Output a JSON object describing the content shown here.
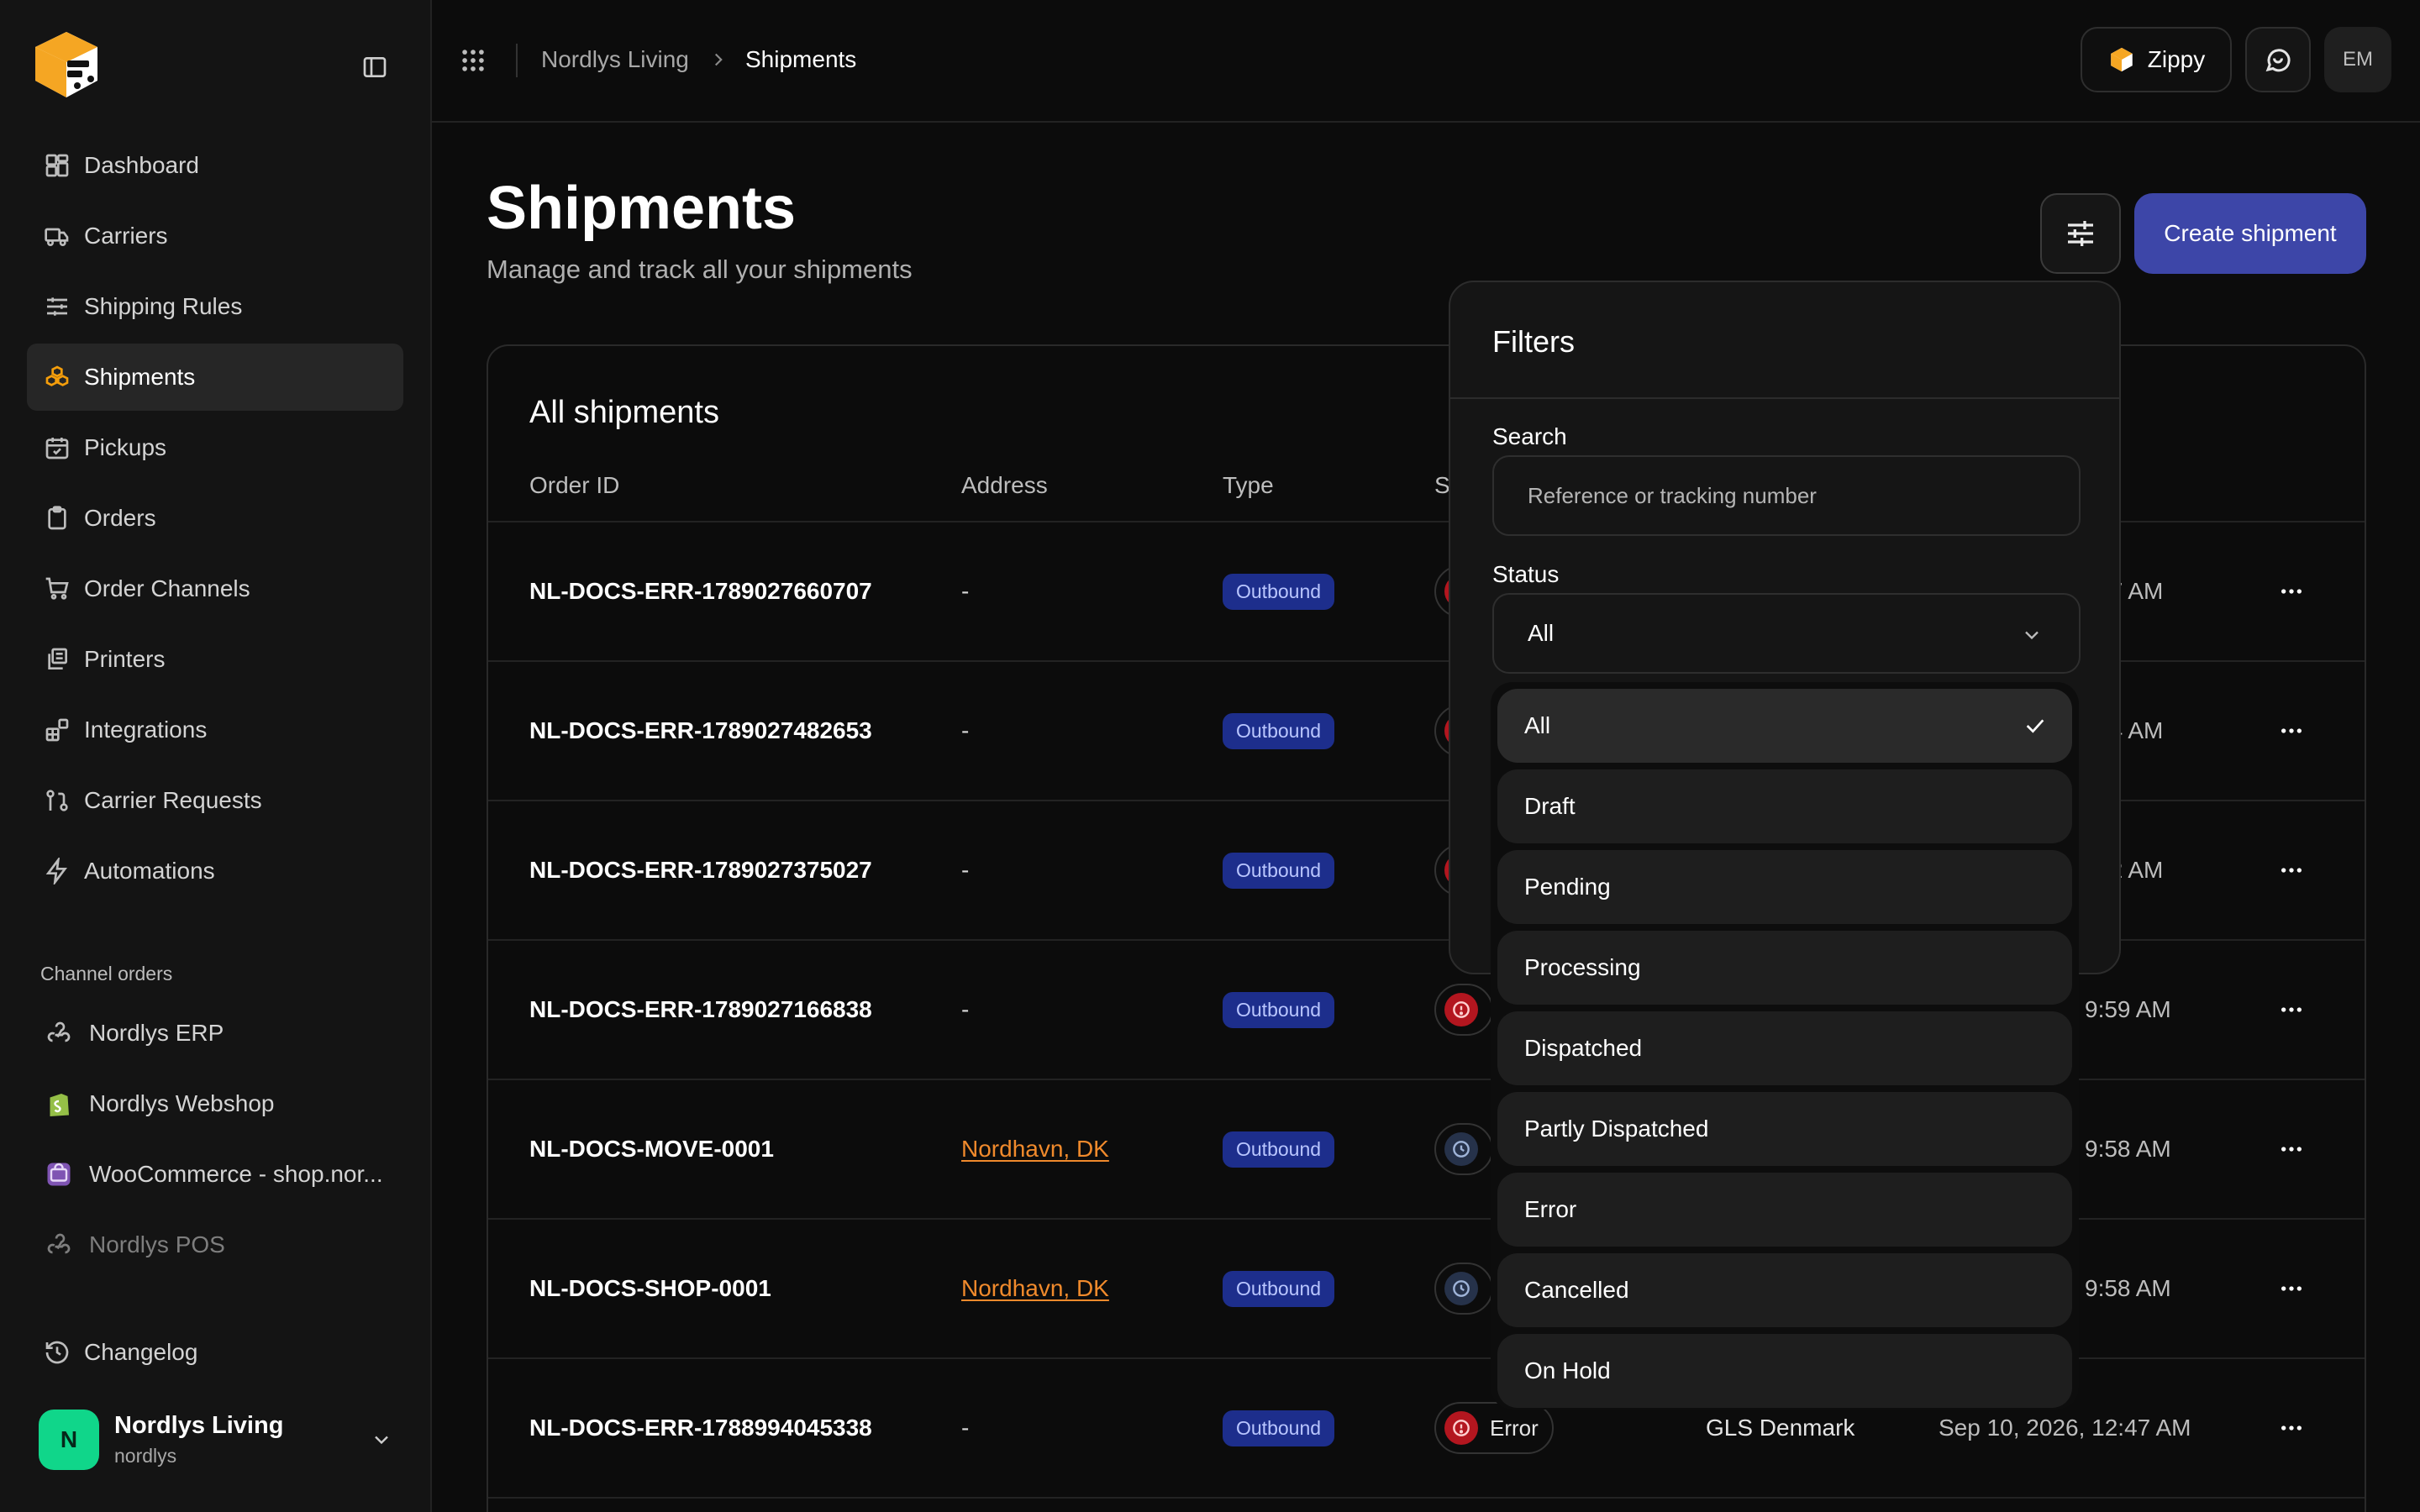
{
  "sidebar": {
    "nav": [
      {
        "label": "Dashboard"
      },
      {
        "label": "Carriers"
      },
      {
        "label": "Shipping Rules"
      },
      {
        "label": "Shipments"
      },
      {
        "label": "Pickups"
      },
      {
        "label": "Orders"
      },
      {
        "label": "Order Channels"
      },
      {
        "label": "Printers"
      },
      {
        "label": "Integrations"
      },
      {
        "label": "Carrier Requests"
      },
      {
        "label": "Automations"
      }
    ],
    "active_item": "Shipments",
    "section_label": "Channel orders",
    "channels": [
      {
        "label": "Nordlys ERP",
        "icon": "webhook-icon"
      },
      {
        "label": "Nordlys Webshop",
        "icon": "shopify-icon"
      },
      {
        "label": "WooCommerce - shop.nor...",
        "icon": "woocommerce-icon"
      },
      {
        "label": "Nordlys POS",
        "icon": "webhook-icon",
        "dimmed": true
      }
    ],
    "changelog_label": "Changelog",
    "account": {
      "initial": "N",
      "name": "Nordlys Living",
      "handle": "nordlys"
    }
  },
  "topbar": {
    "breadcrumb": [
      "Nordlys Living",
      "Shipments"
    ],
    "zippy_label": "Zippy",
    "user_initials": "EM"
  },
  "header": {
    "title": "Shipments",
    "subtitle": "Manage and track all your shipments",
    "create_label": "Create shipment"
  },
  "table": {
    "title": "All shipments",
    "columns": {
      "order_id": "Order ID",
      "address": "Address",
      "type": "Type",
      "status": "S"
    },
    "rows": [
      {
        "order_id": "NL-DOCS-ERR-1789027660707",
        "address": "-",
        "type": "Outbound",
        "status_icon": "error",
        "status": "",
        "carrier": "",
        "date": "07 AM"
      },
      {
        "order_id": "NL-DOCS-ERR-1789027482653",
        "address": "-",
        "type": "Outbound",
        "status_icon": "error",
        "status": "",
        "carrier": "",
        "date": "04 AM"
      },
      {
        "order_id": "NL-DOCS-ERR-1789027375027",
        "address": "-",
        "type": "Outbound",
        "status_icon": "error",
        "status": "",
        "carrier": "",
        "date": "02 AM"
      },
      {
        "order_id": "NL-DOCS-ERR-1789027166838",
        "address": "-",
        "type": "Outbound",
        "status_icon": "error",
        "status": "",
        "carrier": "",
        "date": "9:59 AM"
      },
      {
        "order_id": "NL-DOCS-MOVE-0001",
        "address": "Nordhavn, DK",
        "type": "Outbound",
        "status_icon": "clock",
        "status": "",
        "carrier": "",
        "date": "9:58 AM"
      },
      {
        "order_id": "NL-DOCS-SHOP-0001",
        "address": "Nordhavn, DK",
        "type": "Outbound",
        "status_icon": "clock",
        "status": "",
        "carrier": "",
        "date": "9:58 AM"
      },
      {
        "order_id": "NL-DOCS-ERR-1788994045338",
        "address": "-",
        "type": "Outbound",
        "status_icon": "error",
        "status": "Error",
        "carrier": "GLS Denmark",
        "date": "Sep 10, 2026, 12:47 AM"
      }
    ]
  },
  "filters": {
    "title": "Filters",
    "search_label": "Search",
    "search_placeholder": "Reference or tracking number",
    "status_label": "Status",
    "status_value": "All",
    "status_options": [
      "All",
      "Draft",
      "Pending",
      "Processing",
      "Dispatched",
      "Partly Dispatched",
      "Error",
      "Cancelled",
      "On Hold"
    ],
    "selected_option": "All"
  },
  "colors": {
    "accent": "#3d46a8",
    "brand_orange": "#f59e0b",
    "link": "#f08a2c",
    "error": "#b3161f",
    "outbound_badge": "#1d2e8c"
  }
}
